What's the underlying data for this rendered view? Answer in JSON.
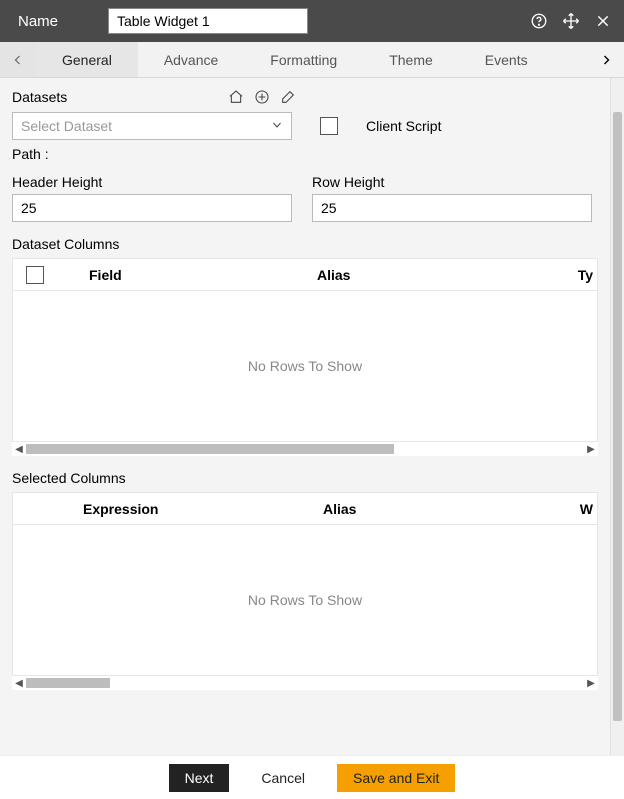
{
  "titlebar": {
    "name_label": "Name",
    "name_value": "Table Widget 1"
  },
  "tabs": {
    "items": [
      "General",
      "Advance",
      "Formatting",
      "Theme",
      "Events"
    ],
    "active_index": 0
  },
  "datasets": {
    "label": "Datasets",
    "placeholder": "Select Dataset",
    "client_script_label": "Client Script",
    "path_label": "Path :"
  },
  "heights": {
    "header_label": "Header Height",
    "header_value": "25",
    "row_label": "Row Height",
    "row_value": "25"
  },
  "dataset_columns": {
    "title": "Dataset Columns",
    "headers": {
      "field": "Field",
      "alias": "Alias",
      "type_partial": "Ty"
    },
    "empty": "No Rows To Show"
  },
  "selected_columns": {
    "title": "Selected Columns",
    "headers": {
      "expression": "Expression",
      "alias": "Alias",
      "w_partial": "W"
    },
    "empty": "No Rows To Show"
  },
  "footer": {
    "next": "Next",
    "cancel": "Cancel",
    "save": "Save and Exit"
  }
}
